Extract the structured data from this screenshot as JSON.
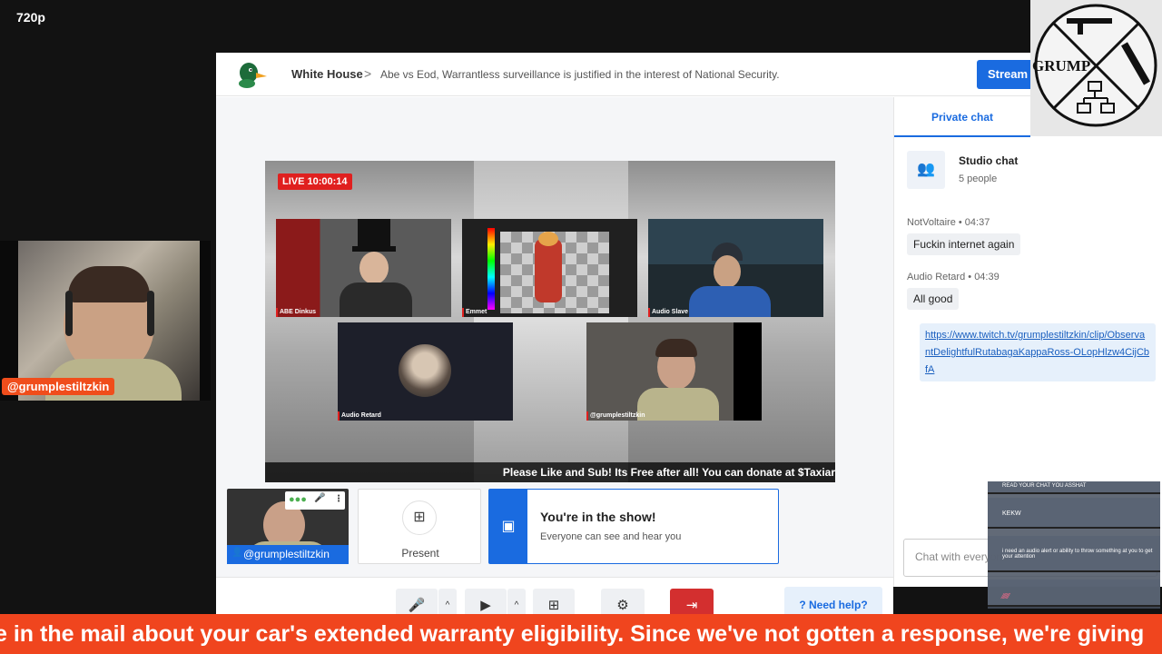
{
  "resolution_label": "720p",
  "webcam": {
    "username": "@grumplestiltzkin"
  },
  "header": {
    "breadcrumb_root": "White House",
    "breadcrumb_separator": ">",
    "title": "Abe vs Eod, Warrantless surveillance is justified in the interest of National Security.",
    "stream_button": "Stream t"
  },
  "stage": {
    "live_badge": "LIVE 10:00:14",
    "tiles": [
      {
        "label": "ABE Dinkus"
      },
      {
        "label": "Emmet"
      },
      {
        "label": "Audio Slave"
      },
      {
        "label": "Audio Retard"
      },
      {
        "label": "@grumplestiltzkin"
      }
    ],
    "ticker_text": "Please Like and Sub! Its Free after all! You can donate at $Taxiar"
  },
  "self_card": {
    "name": "@grumplestiltzkin"
  },
  "present_card": {
    "label": "Present"
  },
  "in_show_card": {
    "title": "You're in the show!",
    "subtitle": "Everyone can see and hear you"
  },
  "controls": {
    "help_label": "Need help?"
  },
  "chat": {
    "tab_label": "Private chat",
    "room_title": "Studio chat",
    "room_subtitle": "5 people",
    "messages": [
      {
        "author": "NotVoltaire",
        "time": "04:37",
        "text": "Fuckin internet again"
      },
      {
        "author": "Audio Retard",
        "time": "04:39",
        "text": "All good"
      }
    ],
    "link_message": "https://www.twitch.tv/grumplestiltzkin/clip/ObservantDelightfulRutabagaKappaRoss-OLopHlzw4CijCbfA",
    "input_placeholder": "Chat with everyone"
  },
  "logo": {
    "text": "GRUMP"
  },
  "overlay_chat": {
    "rows": [
      {
        "text": "READ YOUR CHAT YOU ASSHAT"
      },
      {
        "text": "KEKW"
      },
      {
        "text": "i need an audio alert or ability to throw something at you to get your attention"
      }
    ]
  },
  "bottom_ticker": {
    "text": "e in the mail about your car's extended warranty eligibility. Since we've not gotten a response, we're giving"
  },
  "colors": {
    "accent": "#1a6be0",
    "live_red": "#e0201f",
    "ticker_orange": "#f0451e"
  }
}
